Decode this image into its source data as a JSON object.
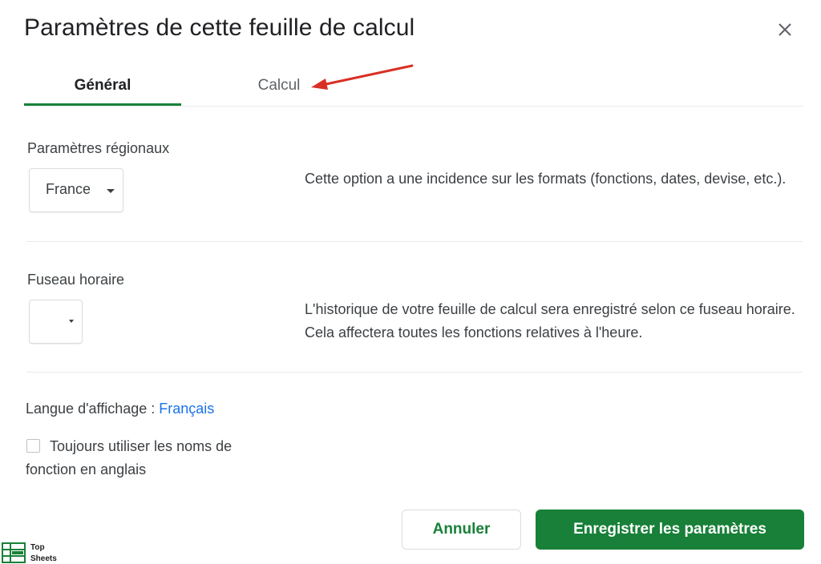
{
  "dialog": {
    "title": "Paramètres de cette feuille de calcul",
    "close_icon": "close-icon"
  },
  "tabs": [
    {
      "label": "Général",
      "active": true
    },
    {
      "label": "Calcul",
      "active": false
    }
  ],
  "annotation": {
    "arrow_color": "#d93025",
    "arrow_icon": "arrow-annotation"
  },
  "locale": {
    "label": "Paramètres régionaux",
    "value": "France",
    "description": "Cette option a une incidence sur les formats (fonctions, dates, devise, etc.)."
  },
  "timezone": {
    "label": "Fuseau horaire",
    "value": "",
    "description": "L'historique de votre feuille de calcul sera enregistré selon ce fuseau horaire. Cela affectera toutes les fonctions relatives à l'heure."
  },
  "language": {
    "label": "Langue d'affichage : ",
    "value": "Français"
  },
  "english_functions": {
    "label": "Toujours utiliser les noms de fonction en anglais",
    "checked": false
  },
  "buttons": {
    "cancel": "Annuler",
    "save": "Enregistrer les paramètres"
  },
  "watermark": {
    "line1": "Top",
    "line2": "Sheets"
  },
  "colors": {
    "accent": "#188038",
    "link": "#1a73e8",
    "arrow": "#d93025"
  }
}
